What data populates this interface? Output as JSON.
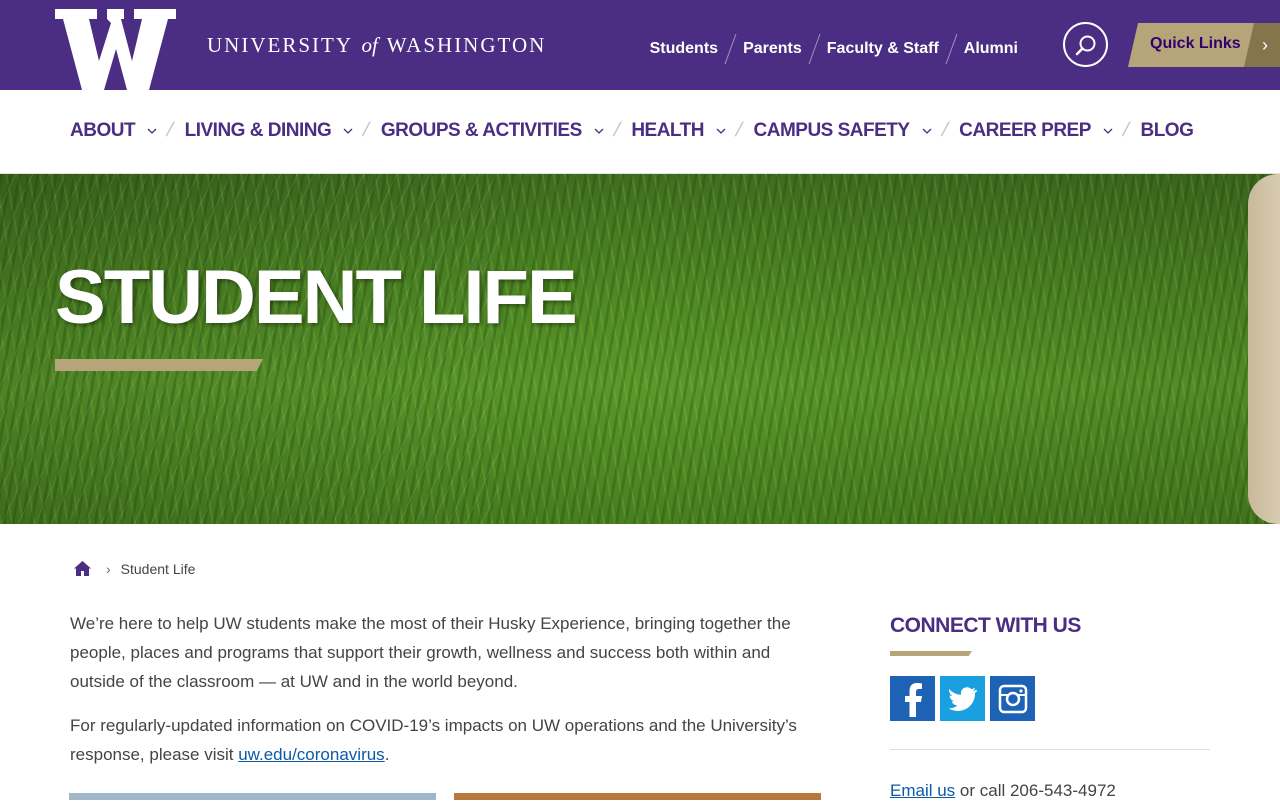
{
  "header": {
    "logo_letter": "W",
    "wordmark_pre": "UNIVERSITY",
    "wordmark_of": "of",
    "wordmark_post": "WASHINGTON",
    "audience_links": [
      "Students",
      "Parents",
      "Faculty & Staff",
      "Alumni"
    ],
    "search_icon": "search-icon",
    "quick_links_label": "Quick Links",
    "quick_links_arrow": "›"
  },
  "nav": {
    "items": [
      {
        "label": "ABOUT",
        "has_dropdown": true
      },
      {
        "label": "LIVING & DINING",
        "has_dropdown": true
      },
      {
        "label": "GROUPS & ACTIVITIES",
        "has_dropdown": true
      },
      {
        "label": "HEALTH",
        "has_dropdown": true
      },
      {
        "label": "CAMPUS SAFETY",
        "has_dropdown": true
      },
      {
        "label": "CAREER PREP",
        "has_dropdown": true
      },
      {
        "label": "BLOG",
        "has_dropdown": false
      }
    ]
  },
  "hero": {
    "title": "STUDENT LIFE"
  },
  "breadcrumb": {
    "home_icon": "home-icon",
    "separator": "›",
    "current": "Student Life"
  },
  "content": {
    "intro": "We’re here to help UW students make the most of their Husky Experience, bringing together the people, places and programs that support their growth, wellness and success both within and outside of the classroom — at UW and in the world beyond.",
    "covid_pre": "For regularly-updated information on COVID-19’s impacts on UW operations and the University’s response, please visit ",
    "covid_link": "uw.edu/coronavirus",
    "covid_post": "."
  },
  "sidebar": {
    "connect_title": "CONNECT WITH US",
    "social": [
      "facebook-icon",
      "twitter-icon",
      "instagram-icon"
    ],
    "email_link": "Email us",
    "call_text": " or call 206-543-4972"
  },
  "colors": {
    "purple": "#4b2e83",
    "gold": "#b7a57a",
    "dark_gold": "#85754d",
    "link": "#0c5aa8"
  }
}
